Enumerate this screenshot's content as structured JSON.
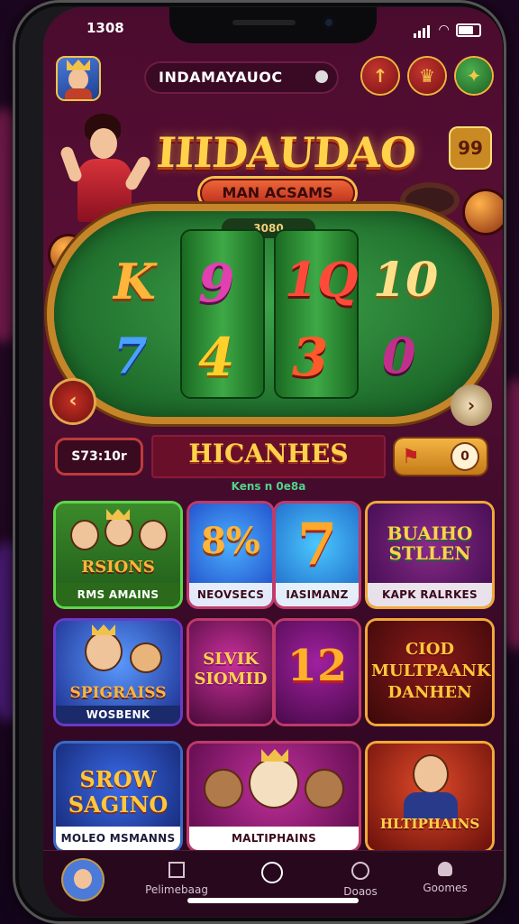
{
  "status_bar": {
    "time": "1308"
  },
  "header": {
    "search_text": "INDAMAYAUOC",
    "buttons": [
      "up-arrow-icon",
      "trophy-icon",
      "gift-icon"
    ]
  },
  "hero": {
    "title": "IIIDAUDAO",
    "subtitle": "MAN ACSAMS",
    "table_label": "3080",
    "corner_badge": "99",
    "reels_top": [
      "K",
      "9",
      "1Q",
      "10"
    ],
    "reels_bottom": [
      "7",
      "4",
      "3",
      "0"
    ]
  },
  "bar": {
    "balance": "S73:10r",
    "banner_title": "HICANHES",
    "banner_sub": "Kens n 0e8a",
    "toggle_knob": "0"
  },
  "games": [
    {
      "top": "RSIONS",
      "caption": "RMS AMAINS"
    },
    {
      "top": "8%",
      "caption": "NEOVSECS"
    },
    {
      "top": "7",
      "caption": "IASIMANZ"
    },
    {
      "top": "BUAIHO STLLEN",
      "caption": "KAPK RALRKES"
    },
    {
      "top": "SPIGRAISS",
      "caption": "WOSBENK"
    },
    {
      "top": "SLVIK SIOMID",
      "caption": ""
    },
    {
      "top": "12",
      "caption": ""
    },
    {
      "top": "CIOD MULTPAANK DANHEN",
      "caption": ""
    },
    {
      "top": "SROW SAGINO",
      "caption": "MOLEO MSMANNS"
    },
    {
      "top": "",
      "caption": "MALTIPHAINS"
    },
    {
      "top": "",
      "caption": "HLTIPHAINS"
    }
  ],
  "nav": {
    "items": [
      "Pelimebaag",
      "Doaos",
      "Goomes"
    ]
  },
  "colors": {
    "gold": "#ffd24a",
    "felt": "#2f8a3a",
    "bg": "#4a0c2e"
  }
}
